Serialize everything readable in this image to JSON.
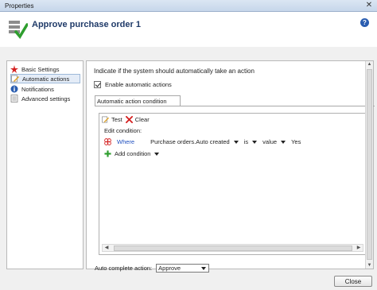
{
  "window": {
    "title": "Properties",
    "close_glyph": "✕"
  },
  "header": {
    "title": "Approve purchase order 1",
    "help_glyph": "?"
  },
  "nav": {
    "items": [
      {
        "label": "Basic Settings",
        "icon": "red-star-icon"
      },
      {
        "label": "Automatic actions",
        "icon": "pencil-icon",
        "selected": true
      },
      {
        "label": "Notifications",
        "icon": "info-icon"
      },
      {
        "label": "Advanced settings",
        "icon": "document-icon"
      }
    ]
  },
  "main": {
    "instruction": "Indicate if the system should automatically take an action",
    "enable_label": "Enable automatic actions",
    "enable_checked": true,
    "tab_label": "Automatic action condition",
    "toolbar": {
      "test_label": "Test",
      "clear_label": "Clear"
    },
    "edit_condition_label": "Edit condition:",
    "condition": {
      "where_label": "Where",
      "field": "Purchase orders.Auto created",
      "operator": "is",
      "value_type": "value",
      "value": "Yes"
    },
    "add_condition_label": "Add condition",
    "auto_complete_label": "Auto complete action:",
    "auto_complete_value": "Approve"
  },
  "footer": {
    "close_label": "Close"
  },
  "colors": {
    "link": "#1f4fbf",
    "header_title": "#1f3a68",
    "check_green": "#2e9e2e",
    "delete_red": "#d42020"
  }
}
